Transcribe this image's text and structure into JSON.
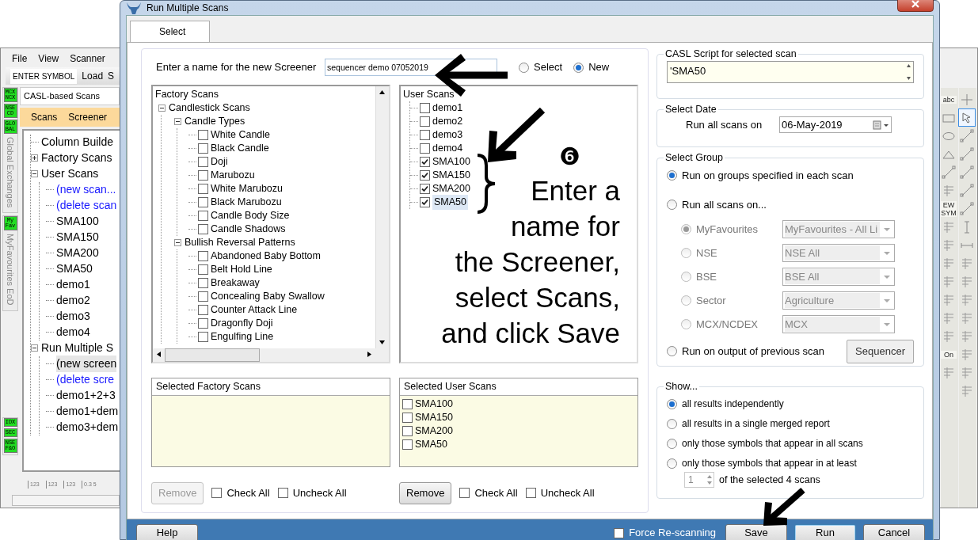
{
  "background_window": {
    "menu": [
      "File",
      "View",
      "Scanner"
    ],
    "symbol_field": {
      "value": "ENTER SYMBOL"
    },
    "toolbar_buttons": [
      "Load",
      "S"
    ],
    "side_groups": [
      {
        "badges": [
          "MCX NCX",
          "NSE CD",
          "GLO BAL"
        ],
        "label": "Global Exchanges"
      },
      {
        "badges": [
          "My Fav"
        ],
        "label": "MyFavourites EoD"
      },
      {
        "badges": [
          "IDX",
          "SEC",
          "NSE F&O"
        ]
      }
    ],
    "panel_title": "CASL-based Scans",
    "tabs": [
      "Scans",
      "Screener"
    ],
    "tree": [
      {
        "label": "Column Builde",
        "kind": "item",
        "selected": false
      },
      {
        "label": "Factory Scans",
        "kind": "item",
        "selected": false,
        "expanded": false
      },
      {
        "label": "User Scans",
        "kind": "item",
        "selected": false,
        "expanded": true,
        "children": [
          {
            "label": "(new scan...",
            "kind": "link",
            "selected": false
          },
          {
            "label": "(delete scan",
            "kind": "link",
            "selected": false
          },
          {
            "label": "SMA100",
            "kind": "item",
            "selected": false
          },
          {
            "label": "SMA150",
            "kind": "item",
            "selected": false
          },
          {
            "label": "SMA200",
            "kind": "item",
            "selected": false
          },
          {
            "label": "SMA50",
            "kind": "item",
            "selected": false
          },
          {
            "label": "demo1",
            "kind": "item",
            "selected": false
          },
          {
            "label": "demo2",
            "kind": "item",
            "selected": false
          },
          {
            "label": "demo3",
            "kind": "item",
            "selected": false
          },
          {
            "label": "demo4",
            "kind": "item",
            "selected": false
          }
        ]
      },
      {
        "label": "Run Multiple S",
        "kind": "item",
        "selected": false,
        "expanded": true,
        "children": [
          {
            "label": "(new screen",
            "kind": "item",
            "selected": true
          },
          {
            "label": "(delete scre",
            "kind": "link",
            "selected": false
          },
          {
            "label": "demo1+2+3",
            "kind": "item",
            "selected": false
          },
          {
            "label": "demo1+dem",
            "kind": "item",
            "selected": false
          },
          {
            "label": "demo3+dem",
            "kind": "item",
            "selected": false
          }
        ]
      }
    ],
    "bottom_tools": [
      "123",
      "123",
      "123",
      "0.3 5"
    ]
  },
  "right_toolbar": {
    "columns": [
      [
        {
          "kind": "text",
          "label": "abc",
          "selected": false
        },
        {
          "kind": "rect",
          "selected": false
        },
        {
          "kind": "ellipse",
          "selected": false
        },
        {
          "kind": "triangle",
          "selected": false
        },
        {
          "kind": "diag",
          "selected": false
        },
        {
          "kind": "glyph",
          "selected": false
        },
        {
          "kind": "text",
          "label": "EW SYM",
          "selected": false
        },
        {
          "kind": "glyph",
          "selected": false
        },
        {
          "kind": "glyph",
          "selected": false
        },
        {
          "kind": "glyph",
          "selected": false
        },
        {
          "kind": "glyph",
          "selected": false
        },
        {
          "kind": "glyph",
          "selected": false
        },
        {
          "kind": "glyph",
          "selected": false
        },
        {
          "kind": "glyph",
          "selected": false
        },
        {
          "kind": "text",
          "label": "On",
          "selected": false
        },
        {
          "kind": "glyph",
          "selected": false
        }
      ],
      [
        {
          "kind": "plus",
          "selected": false
        },
        {
          "kind": "pointer",
          "selected": true
        },
        {
          "kind": "diag",
          "selected": false
        },
        {
          "kind": "diag",
          "selected": false
        },
        {
          "kind": "diag",
          "selected": false
        },
        {
          "kind": "diag",
          "selected": false
        },
        {
          "kind": "diag",
          "selected": false
        },
        {
          "kind": "vline",
          "selected": false
        },
        {
          "kind": "hline",
          "selected": false
        },
        {
          "kind": "glyph",
          "selected": false
        },
        {
          "kind": "glyph",
          "selected": false
        },
        {
          "kind": "glyph",
          "selected": false
        },
        {
          "kind": "glyph",
          "selected": false
        },
        {
          "kind": "glyph",
          "selected": false
        },
        {
          "kind": "glyph",
          "selected": false
        },
        {
          "kind": "glyph",
          "selected": false
        },
        {
          "kind": "glyph",
          "selected": false
        }
      ]
    ]
  },
  "dialog": {
    "title": "Run Multiple Scans",
    "tabs": [
      {
        "label": "Select",
        "selected": true
      }
    ],
    "name_label": "Enter a name for the new Screener",
    "name_field": {
      "value": "sequencer demo 07052019"
    },
    "mode_options": [
      {
        "label": "Select",
        "selected": false
      },
      {
        "label": "New",
        "selected": true
      }
    ],
    "factory_scans": {
      "title": "Factory Scans",
      "tree": [
        {
          "label": "Candlestick Scans",
          "expanded": true,
          "children": [
            {
              "label": "Candle Types",
              "expanded": true,
              "children": [
                {
                  "label": "White Candle",
                  "checked": false
                },
                {
                  "label": "Black Candle",
                  "checked": false
                },
                {
                  "label": "Doji",
                  "checked": false
                },
                {
                  "label": "Marubozu",
                  "checked": false
                },
                {
                  "label": "White Marubozu",
                  "checked": false
                },
                {
                  "label": "Black Marubozu",
                  "checked": false
                },
                {
                  "label": "Candle Body Size",
                  "checked": false
                },
                {
                  "label": "Candle Shadows",
                  "checked": false
                }
              ]
            },
            {
              "label": "Bullish Reversal Patterns",
              "expanded": true,
              "children": [
                {
                  "label": "Abandoned Baby Bottom",
                  "checked": false
                },
                {
                  "label": "Belt Hold Line",
                  "checked": false
                },
                {
                  "label": "Breakaway",
                  "checked": false
                },
                {
                  "label": "Concealing Baby Swallow",
                  "checked": false
                },
                {
                  "label": "Counter Attack Line",
                  "checked": false
                },
                {
                  "label": "Dragonfly Doji",
                  "checked": false
                },
                {
                  "label": "Engulfing Line",
                  "checked": false
                }
              ]
            }
          ]
        }
      ]
    },
    "user_scans": {
      "title": "User Scans",
      "items": [
        {
          "label": "demo1",
          "checked": false,
          "selected": false
        },
        {
          "label": "demo2",
          "checked": false,
          "selected": false
        },
        {
          "label": "demo3",
          "checked": false,
          "selected": false
        },
        {
          "label": "demo4",
          "checked": false,
          "selected": false
        },
        {
          "label": "SMA100",
          "checked": true,
          "selected": false
        },
        {
          "label": "SMA150",
          "checked": true,
          "selected": false
        },
        {
          "label": "SMA200",
          "checked": true,
          "selected": false
        },
        {
          "label": "SMA50",
          "checked": true,
          "selected": true
        }
      ]
    },
    "selected_factory": {
      "title": "Selected Factory Scans"
    },
    "selected_user": {
      "title": "Selected User Scans",
      "items": [
        {
          "label": "SMA100",
          "checked": false
        },
        {
          "label": "SMA150",
          "checked": false
        },
        {
          "label": "SMA200",
          "checked": false
        },
        {
          "label": "SMA50",
          "checked": false
        }
      ]
    },
    "factory_actions": {
      "remove": {
        "label": "Remove",
        "disabled": true
      },
      "check_all": {
        "label": "Check All",
        "checked": false
      },
      "uncheck_all": {
        "label": "Uncheck All",
        "checked": false
      }
    },
    "user_actions": {
      "remove": {
        "label": "Remove",
        "disabled": false
      },
      "check_all": {
        "label": "Check All",
        "checked": false
      },
      "uncheck_all": {
        "label": "Uncheck All",
        "checked": false
      }
    },
    "script": {
      "title": "CASL Script for selected scan",
      "value": "'SMA50"
    },
    "date": {
      "title": "Select Date",
      "label": "Run all scans on",
      "value": "06-May-2019"
    },
    "group": {
      "title": "Select Group",
      "options": [
        {
          "label": "Run on groups specified in each scan",
          "selected": true
        },
        {
          "label": "Run all scans on...",
          "selected": false
        },
        {
          "label": "Run on output of previous scan",
          "selected": false,
          "button": "Sequencer"
        }
      ],
      "sub_options": [
        {
          "label": "MyFavourites",
          "selected": true,
          "disabled": true,
          "dropdown": "MyFavourites - All Li"
        },
        {
          "label": "NSE",
          "selected": false,
          "disabled": true,
          "dropdown": "NSE All"
        },
        {
          "label": "BSE",
          "selected": false,
          "disabled": true,
          "dropdown": "BSE All"
        },
        {
          "label": "Sector",
          "selected": false,
          "disabled": true,
          "dropdown": "Agriculture"
        },
        {
          "label": "MCX/NCDEX",
          "selected": false,
          "disabled": true,
          "dropdown": "MCX"
        }
      ]
    },
    "show": {
      "title": "Show...",
      "options": [
        {
          "label": "all results independently",
          "selected": true
        },
        {
          "label": "all results in a single merged report",
          "selected": false
        },
        {
          "label": "only those symbols that appear in all scans",
          "selected": false
        },
        {
          "label": "only those symbols that appear in at least",
          "selected": false
        }
      ],
      "spinner": "1",
      "spinner_label": "of the selected 4 scans"
    },
    "footer": {
      "help": "Help",
      "force": {
        "label": "Force Re-scanning",
        "checked": false
      },
      "buttons": [
        {
          "label": "Save",
          "focused": false
        },
        {
          "label": "Run",
          "focused": true
        },
        {
          "label": "Cancel",
          "focused": false
        }
      ]
    },
    "callout": {
      "step": "❻",
      "lines": [
        "Enter a",
        "name for",
        "the Screener,",
        "select Scans,",
        "and click Save"
      ]
    }
  }
}
